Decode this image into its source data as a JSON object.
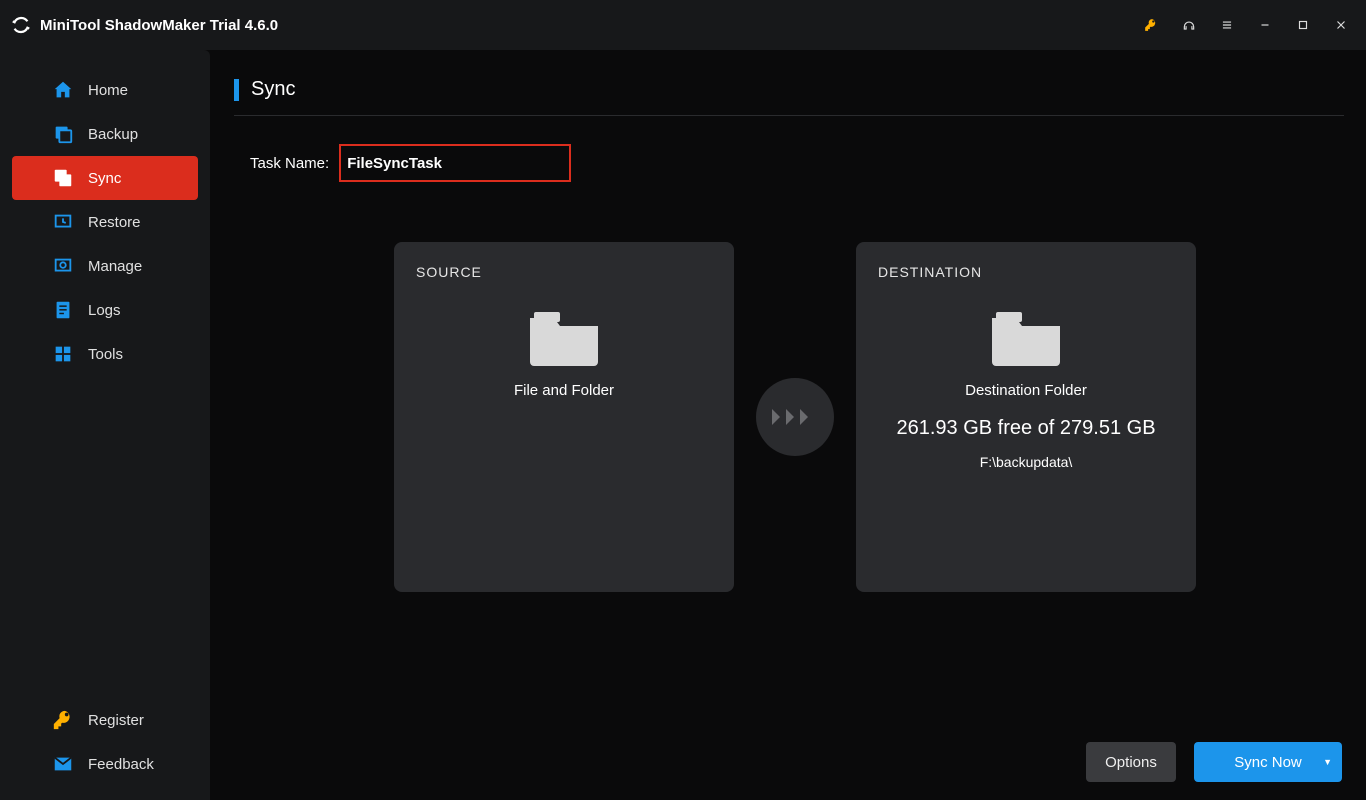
{
  "app": {
    "title": "MiniTool ShadowMaker Trial 4.6.0"
  },
  "sidebar": {
    "items": [
      {
        "label": "Home"
      },
      {
        "label": "Backup"
      },
      {
        "label": "Sync"
      },
      {
        "label": "Restore"
      },
      {
        "label": "Manage"
      },
      {
        "label": "Logs"
      },
      {
        "label": "Tools"
      }
    ],
    "register": "Register",
    "feedback": "Feedback"
  },
  "page": {
    "heading": "Sync",
    "task_label": "Task Name:",
    "task_value": "FileSyncTask",
    "source": {
      "title": "SOURCE",
      "sub": "File and Folder"
    },
    "dest": {
      "title": "DESTINATION",
      "sub": "Destination Folder",
      "free": "261.93 GB free of 279.51 GB",
      "path": "F:\\backupdata\\"
    },
    "options_btn": "Options",
    "sync_btn": "Sync Now"
  }
}
